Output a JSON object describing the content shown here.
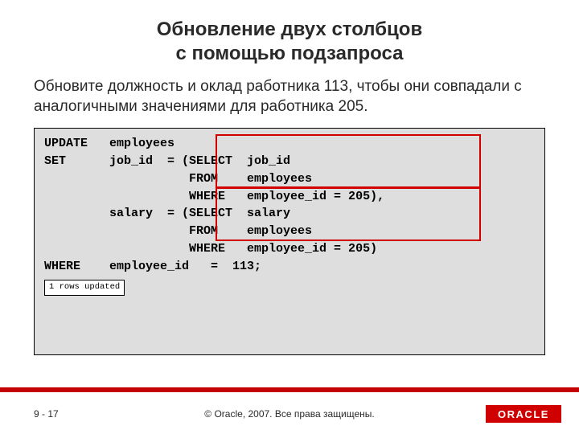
{
  "title": {
    "line1": "Обновление двух столбцов",
    "line2": "с помощью подзапроса"
  },
  "instruction": "Обновите должность и оклад работника 113, чтобы они совпадали с аналогичными значениями для работника 205.",
  "code": "UPDATE   employees\nSET      job_id  = (SELECT  job_id\n                    FROM    employees\n                    WHERE   employee_id = 205),\n         salary  = (SELECT  salary\n                    FROM    employees\n                    WHERE   employee_id = 205)\nWHERE    employee_id   =  113;",
  "status": "1 rows updated",
  "footer": {
    "page": "9 - 17",
    "copyright": "© Oracle, 2007. Все права защищены.",
    "logo": "ORACLE"
  }
}
